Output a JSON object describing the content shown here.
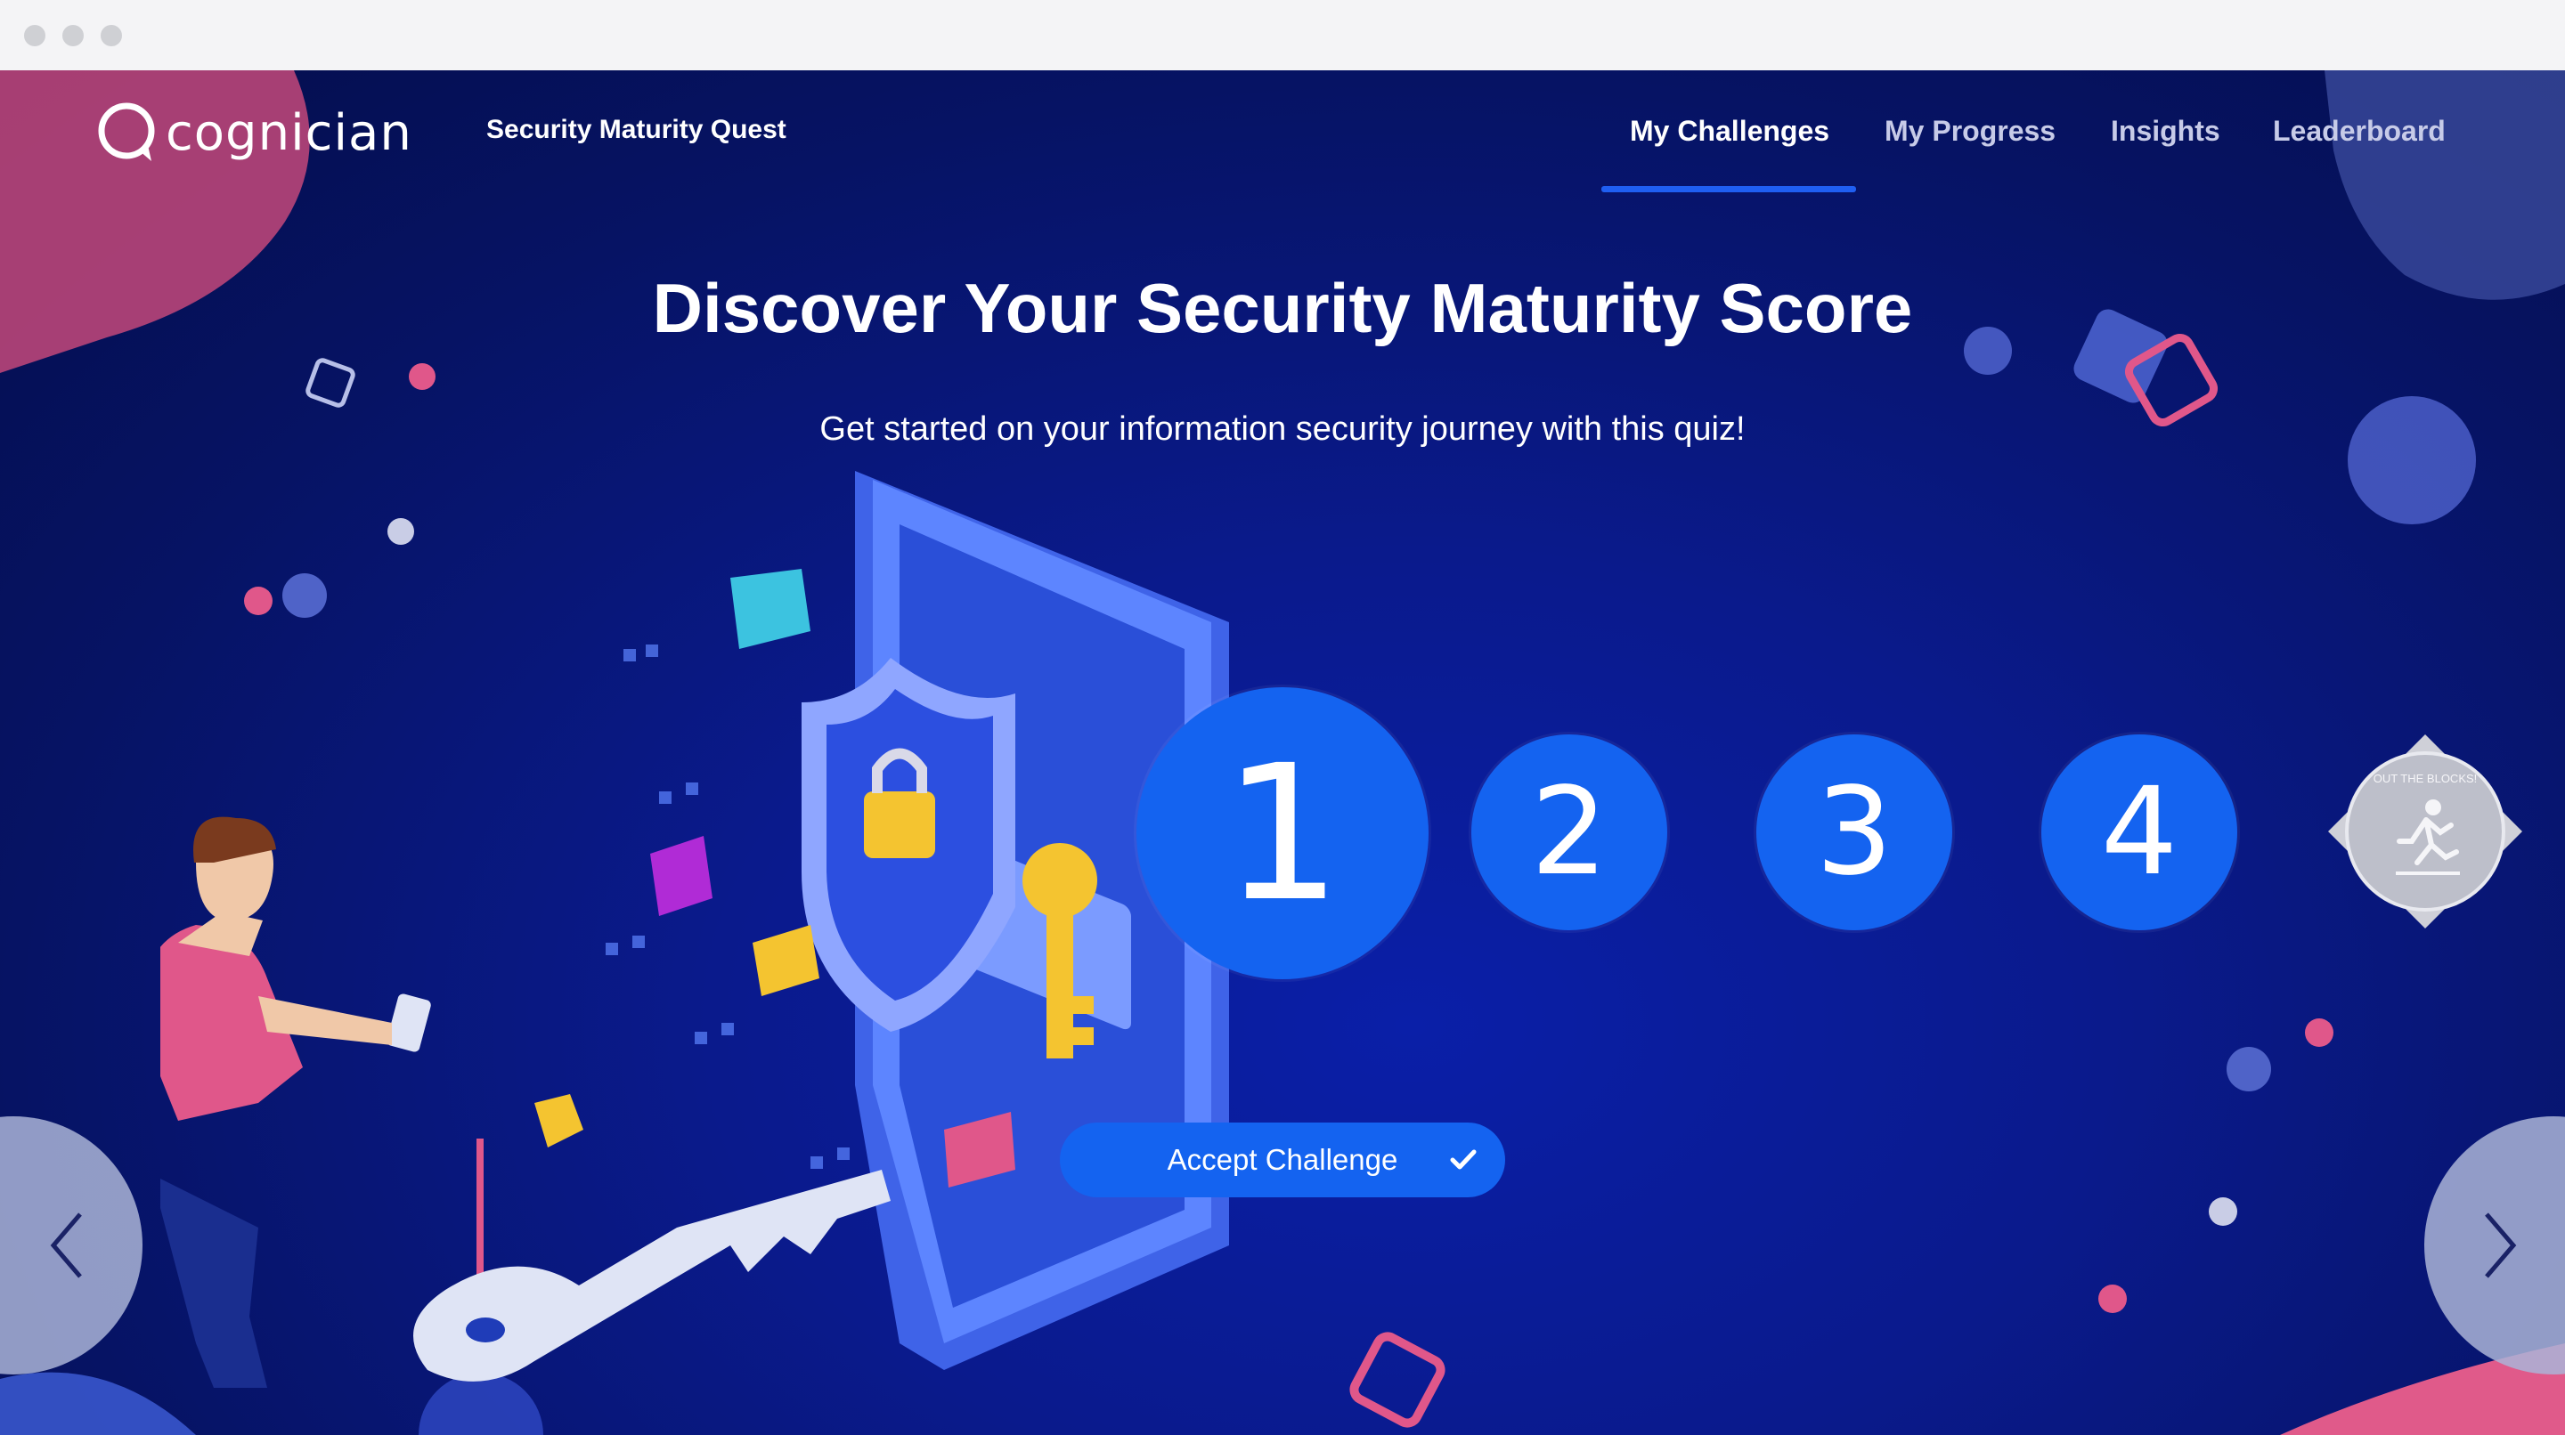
{
  "app": {
    "logo_text": "cognician",
    "title": "Security Maturity Quest"
  },
  "nav": {
    "items": [
      {
        "label": "My Challenges",
        "active": true
      },
      {
        "label": "My Progress",
        "active": false
      },
      {
        "label": "Insights",
        "active": false
      },
      {
        "label": "Leaderboard",
        "active": false
      }
    ]
  },
  "hero": {
    "headline": "Discover Your Security Maturity Score",
    "subline": "Get started on your information security journey with this quiz!"
  },
  "steps": {
    "items": [
      "1",
      "2",
      "3",
      "4"
    ],
    "current": "1",
    "badge_text": "OUT THE BLOCKS!"
  },
  "cta": {
    "accept_label": "Accept Challenge"
  },
  "icons": {
    "prev": "chevron-left-icon",
    "next": "chevron-right-icon",
    "check": "check-icon"
  },
  "colors": {
    "accent": "#1463f0",
    "pink": "#e8467c",
    "background": "#0a1a8c"
  }
}
